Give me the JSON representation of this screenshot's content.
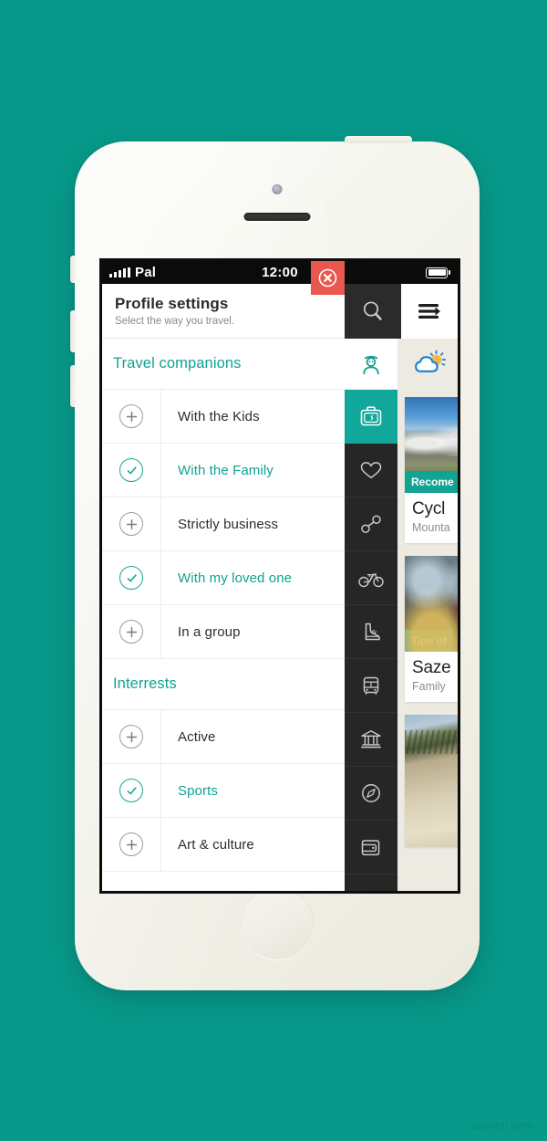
{
  "background": {
    "color": "#07998a",
    "watermark": "uisheji.com"
  },
  "theme": {
    "teal": "#11a393",
    "teal_active": "#11a79a",
    "dark": "#262626",
    "red": "#e8584f",
    "panel": "#eceae1"
  },
  "status_bar": {
    "carrier": "Pal",
    "time": "12:00",
    "signal_icon": "signal-bars-icon",
    "battery_icon": "battery-full-icon"
  },
  "header": {
    "title": "Profile settings",
    "subtitle": "Select the way you travel.",
    "close_icon": "close-circle-icon",
    "search_icon": "search-icon",
    "menu_icon": "hamburger-arrow-icon"
  },
  "sections": [
    {
      "label": "Travel companions",
      "icon": "person-icon",
      "items": [
        {
          "label": "With the Kids",
          "selected": false,
          "icon": "plus-circle-icon"
        },
        {
          "label": "With the Family",
          "selected": true,
          "icon": "check-circle-icon"
        },
        {
          "label": "Strictly business",
          "selected": false,
          "icon": "plus-circle-icon"
        },
        {
          "label": "With my loved one",
          "selected": true,
          "icon": "check-circle-icon"
        },
        {
          "label": "In a group",
          "selected": false,
          "icon": "plus-circle-icon"
        }
      ]
    },
    {
      "label": "Interrests",
      "icon": "",
      "items": [
        {
          "label": "Active",
          "selected": false,
          "icon": "plus-circle-icon"
        },
        {
          "label": "Sports",
          "selected": true,
          "icon": "check-circle-icon"
        },
        {
          "label": "Art & culture",
          "selected": false,
          "icon": "plus-circle-icon"
        }
      ]
    }
  ],
  "icon_rail": [
    {
      "icon": "suitcase-icon",
      "active": true
    },
    {
      "icon": "heart-icon",
      "active": false
    },
    {
      "icon": "route-icon",
      "active": false
    },
    {
      "icon": "bicycle-icon",
      "active": false
    },
    {
      "icon": "boot-icon",
      "active": false
    },
    {
      "icon": "bus-icon",
      "active": false
    },
    {
      "icon": "museum-icon",
      "active": false
    },
    {
      "icon": "compass-icon",
      "active": false
    },
    {
      "icon": "wallet-icon",
      "active": false
    }
  ],
  "right_panel": {
    "weather_icon": "sun-cloud-icon",
    "cards": [
      {
        "tag": "Recome",
        "title": "Cycl",
        "subtitle": "Mounta",
        "photo": "mountain-photo"
      },
      {
        "tag": "Tips of",
        "title": "Saze",
        "subtitle": "Family",
        "photo": "dinner-photo"
      },
      {
        "tag": "",
        "title": "",
        "subtitle": "",
        "photo": "beach-photo"
      }
    ]
  }
}
